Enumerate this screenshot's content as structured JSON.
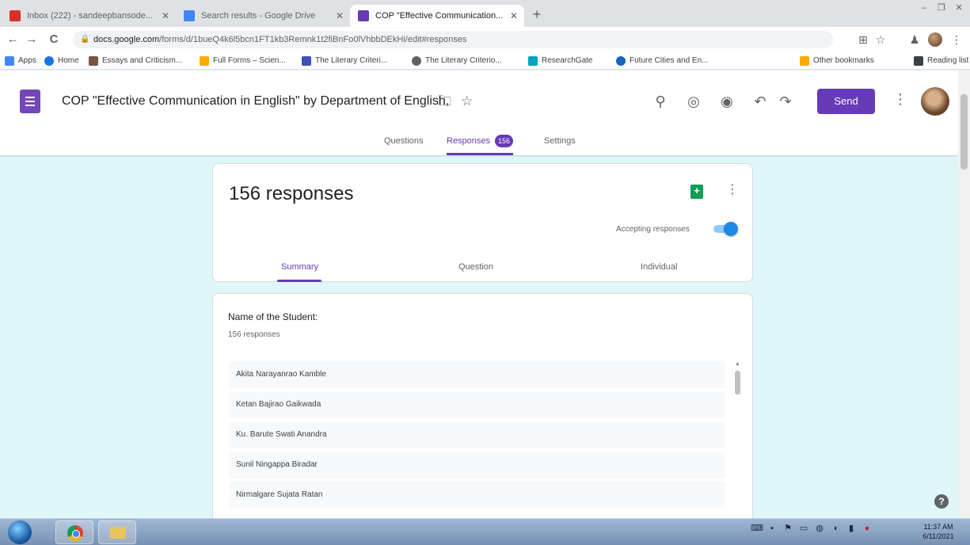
{
  "browser": {
    "tabs": [
      {
        "label": "Inbox (222) - sandeepbansode...",
        "favicon_color": "#d93025"
      },
      {
        "label": "Search results - Google Drive",
        "favicon_color": "#4285f4"
      },
      {
        "label": "COP \"Effective Communication...",
        "favicon_color": "#673ab7"
      }
    ],
    "new_tab": "+",
    "window_controls": {
      "minimize": "–",
      "restore": "❐",
      "close": "✕"
    },
    "nav": {
      "back": "←",
      "forward": "→",
      "reload": "C"
    },
    "url_host": "docs.google.com",
    "url_path": "/forms/d/1bueQ4k6l5bcn1FT1kb3Remnk1t2fiBnFo0lVhbbDEkHi/edit#responses",
    "toolbar_icons": {
      "translate": "⊞",
      "star": "☆",
      "extensions": "♟",
      "menu": "⋮"
    },
    "bookmarks": [
      {
        "label": "Apps",
        "color": "#4285f4"
      },
      {
        "label": "Home",
        "color": "#1a73e8"
      },
      {
        "label": "Essays and Criticism...",
        "color": "#795548"
      },
      {
        "label": "Full Forms – Scien...",
        "color": "#f9ab00"
      },
      {
        "label": "The Literary Criteri...",
        "color": "#3f51b5"
      },
      {
        "label": "The Literary Criterio...",
        "color": "#5f6368"
      },
      {
        "label": "ResearchGate",
        "color": "#00a4bd"
      },
      {
        "label": "Future Cities and En...",
        "color": "#1565c0"
      }
    ],
    "bookmarks_right": [
      {
        "label": "Other bookmarks",
        "color": "#f9ab00"
      },
      {
        "label": "Reading list",
        "color": "#3c4043"
      }
    ]
  },
  "form": {
    "title": "COP \"Effective Communication in English\" by Department of English,",
    "header_icons": [
      "palette-addon",
      "palette",
      "preview",
      "undo",
      "redo"
    ],
    "send_label": "Send",
    "tabs": {
      "questions": "Questions",
      "responses": "Responses",
      "response_count": "156",
      "settings": "Settings"
    },
    "accent_color": "#673ab7"
  },
  "summary": {
    "heading": "156 responses",
    "accepting_label": "Accepting responses",
    "accepting": true,
    "tabs": {
      "summary": "Summary",
      "question": "Question",
      "individual": "Individual"
    }
  },
  "question": {
    "title": "Name of the Student:",
    "count": "156 responses",
    "answers": [
      "Akita Narayanrao Kamble",
      "Ketan Bajirao Gaikwada",
      "Ku. Barute Swati Anandra",
      "Sunil Ningappa Biradar",
      "Nirmalgare Sujata Ratan"
    ]
  },
  "help_label": "?",
  "taskbar": {
    "clock_time": "11:37 AM",
    "clock_date": "6/11/2021"
  }
}
